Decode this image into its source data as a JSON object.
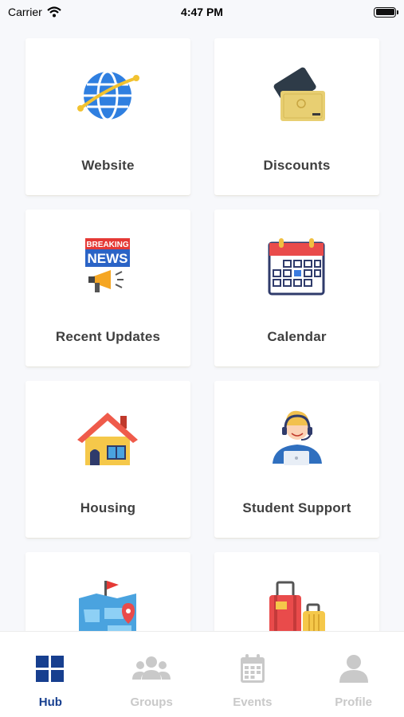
{
  "status_bar": {
    "carrier": "Carrier",
    "time": "4:47 PM"
  },
  "tiles": [
    {
      "label": "Website",
      "icon": "globe-icon"
    },
    {
      "label": "Discounts",
      "icon": "cards-icon"
    },
    {
      "label": "Recent Updates",
      "icon": "breaking-news-icon"
    },
    {
      "label": "Calendar",
      "icon": "calendar-icon"
    },
    {
      "label": "Housing",
      "icon": "house-icon"
    },
    {
      "label": "Student Support",
      "icon": "support-agent-icon"
    },
    {
      "label": "",
      "icon": "map-icon"
    },
    {
      "label": "",
      "icon": "luggage-icon"
    }
  ],
  "news_icon": {
    "line1": "BREAKING",
    "line2": "NEWS"
  },
  "tabs": [
    {
      "label": "Hub",
      "icon": "grid-icon",
      "active": true
    },
    {
      "label": "Groups",
      "icon": "groups-icon",
      "active": false
    },
    {
      "label": "Events",
      "icon": "events-calendar-icon",
      "active": false
    },
    {
      "label": "Profile",
      "icon": "profile-icon",
      "active": false
    }
  ],
  "colors": {
    "active_tab": "#173f8f",
    "inactive_tab": "#c9c9c9",
    "label_text": "#3f3f3f"
  }
}
